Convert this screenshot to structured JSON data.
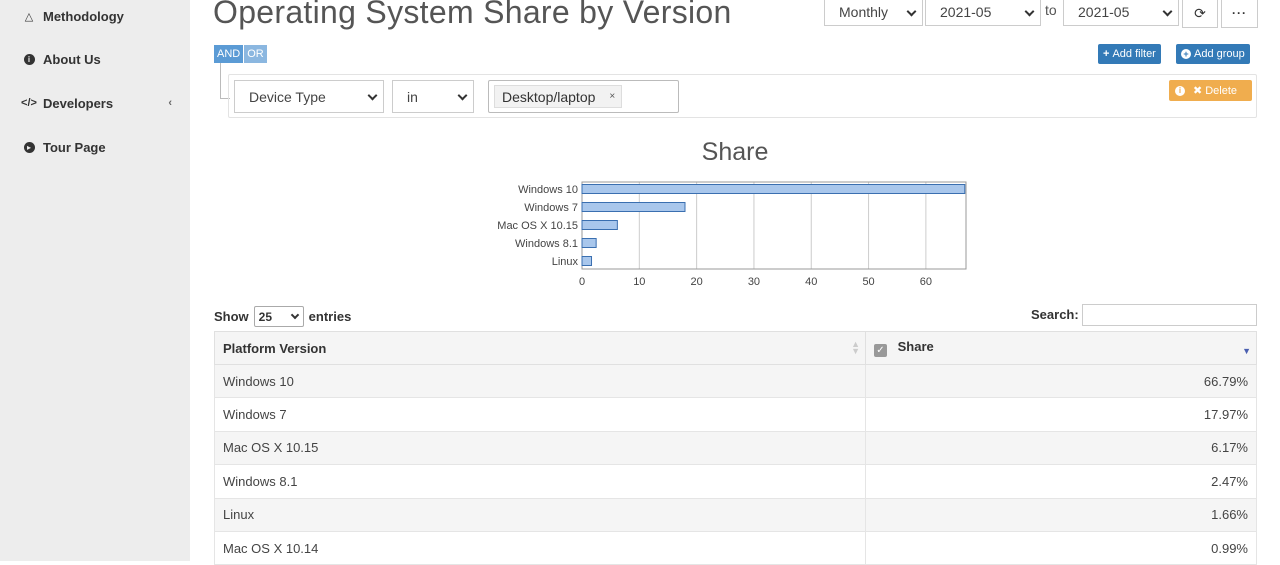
{
  "sidebar": {
    "items": [
      {
        "label": "Methodology",
        "icon": "flask-icon"
      },
      {
        "label": "About Us",
        "icon": "info-circle-icon"
      },
      {
        "label": "Developers",
        "icon": "code-icon"
      },
      {
        "label": "Tour Page",
        "icon": "play-circle-icon"
      }
    ]
  },
  "page": {
    "title": "Operating System Share by Version"
  },
  "controls": {
    "granularity": "Monthly",
    "from": "2021-05",
    "to_label": "to",
    "to": "2021-05"
  },
  "filters": {
    "and_label": "AND",
    "or_label": "OR",
    "add_filter": "Add filter",
    "add_group": "Add group",
    "field": "Device Type",
    "operator": "in",
    "value": "Desktop/laptop",
    "remove_tag": "×",
    "delete_label": "Delete"
  },
  "chart_data": {
    "type": "bar",
    "orientation": "horizontal",
    "title": "Share",
    "categories": [
      "Windows 10",
      "Windows 7",
      "Mac OS X 10.15",
      "Windows 8.1",
      "Linux"
    ],
    "values": [
      66.79,
      17.97,
      6.17,
      2.47,
      1.66
    ],
    "xlim": [
      0,
      67
    ],
    "xticks": [
      0,
      10,
      20,
      30,
      40,
      50,
      60
    ],
    "grid": true,
    "bar_color": "#a9c7ec",
    "bar_stroke": "#3a6fb0"
  },
  "table": {
    "show_label": "Show",
    "page_length": "25",
    "entries_label": "entries",
    "search_label": "Search:",
    "columns": [
      "Platform Version",
      "Share"
    ],
    "rows": [
      {
        "name": "Windows 10",
        "share": "66.79%"
      },
      {
        "name": "Windows 7",
        "share": "17.97%"
      },
      {
        "name": "Mac OS X 10.15",
        "share": "6.17%"
      },
      {
        "name": "Windows 8.1",
        "share": "2.47%"
      },
      {
        "name": "Linux",
        "share": "1.66%"
      },
      {
        "name": "Mac OS X 10.14",
        "share": "0.99%"
      }
    ]
  }
}
